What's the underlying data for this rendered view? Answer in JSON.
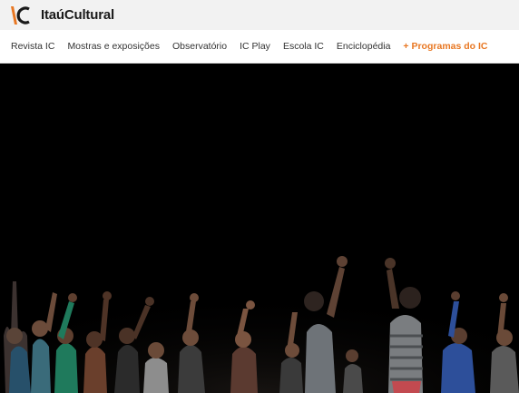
{
  "header": {
    "logo_mark": "IC",
    "logo_text": "ItaúCultural"
  },
  "nav": {
    "items": [
      {
        "label": "Revista IC"
      },
      {
        "label": "Mostras e exposições"
      },
      {
        "label": "Observatório"
      },
      {
        "label": "IC Play"
      },
      {
        "label": "Escola IC"
      },
      {
        "label": "Enciclopédia"
      },
      {
        "label": "+ Programas do IC"
      }
    ]
  },
  "colors": {
    "accent": "#e87722",
    "header_bg": "#f2f2f2",
    "hero_bg": "#000000"
  },
  "icons": {
    "logo": "itau-cultural-logo-icon"
  }
}
